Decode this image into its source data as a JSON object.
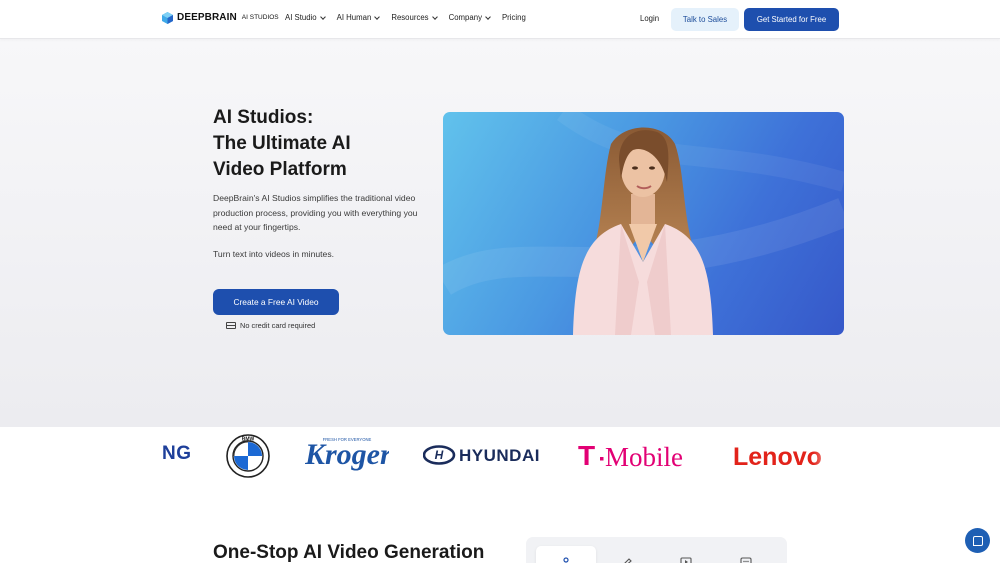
{
  "header": {
    "logo_brand": "DEEPBRAIN",
    "logo_sub": "AI STUDIOS",
    "nav": [
      {
        "label": "AI Studio",
        "has_dropdown": true
      },
      {
        "label": "AI Human",
        "has_dropdown": true
      },
      {
        "label": "Resources",
        "has_dropdown": true
      },
      {
        "label": "Company",
        "has_dropdown": true
      },
      {
        "label": "Pricing",
        "has_dropdown": false
      }
    ],
    "login": "Login",
    "talk_to_sales": "Talk to Sales",
    "get_started": "Get Started for Free"
  },
  "hero": {
    "title_lines": [
      "AI Studios:",
      "The Ultimate AI",
      "Video Platform"
    ],
    "description": "DeepBrain's AI Studios simplifies the traditional video production process, providing you with everything you need at your fingertips.",
    "subline": "Turn text into videos in minutes.",
    "cta": "Create a Free AI Video",
    "no_card": "No credit card required"
  },
  "logos": {
    "partial": "NG",
    "kroger": "Kroger",
    "kroger_tagline": "FRESH FOR EVERYONE",
    "hyundai": "HYUNDAI",
    "tmobile_t": "T",
    "tmobile": "Mobile",
    "lenovo": "Lenovo"
  },
  "section": {
    "title": "One-Stop AI Video Generation"
  },
  "colors": {
    "primary": "#1e4fae",
    "sales_bg": "#e5f1fb",
    "hyundai": "#1a2c5b",
    "tmobile": "#e20074",
    "lenovo": "#e2231a",
    "kroger": "#1e55a5"
  }
}
